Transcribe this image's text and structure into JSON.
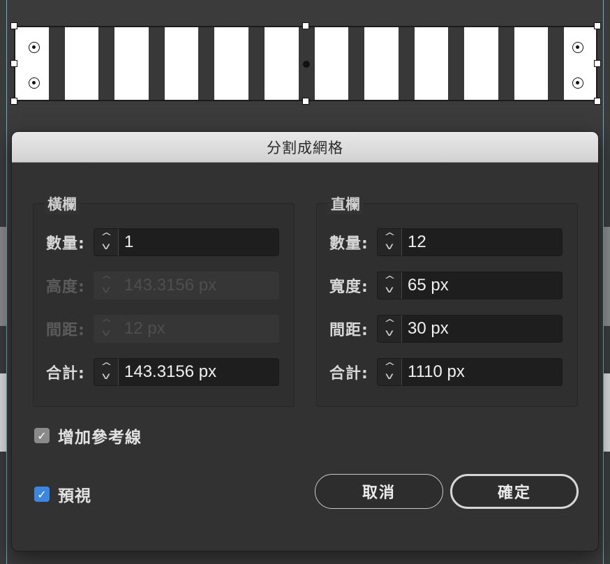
{
  "dialog": {
    "title": "分割成網格",
    "rows_group": {
      "title": "橫欄",
      "count": {
        "label": "數量:",
        "value": "1"
      },
      "height": {
        "label": "高度:",
        "value": "143.3156 px"
      },
      "gutter": {
        "label": "間距:",
        "value": "12 px"
      },
      "total": {
        "label": "合計:",
        "value": "143.3156 px"
      }
    },
    "columns_group": {
      "title": "直欄",
      "count": {
        "label": "數量:",
        "value": "12"
      },
      "width": {
        "label": "寬度:",
        "value": "65 px"
      },
      "gutter": {
        "label": "間距:",
        "value": "30 px"
      },
      "total": {
        "label": "合計:",
        "value": "1110 px"
      }
    },
    "add_guides": {
      "label": "增加參考線",
      "checked": true
    },
    "preview": {
      "label": "預視",
      "checked": true
    },
    "cancel_label": "取消",
    "ok_label": "確定"
  },
  "icons": {
    "spinner": "stepper-arrows-icon",
    "checkmark": "✓"
  },
  "colors": {
    "dialog_bg": "#323232",
    "checkbox_blue": "#3d86e0",
    "guide": "#5fb6c4"
  }
}
